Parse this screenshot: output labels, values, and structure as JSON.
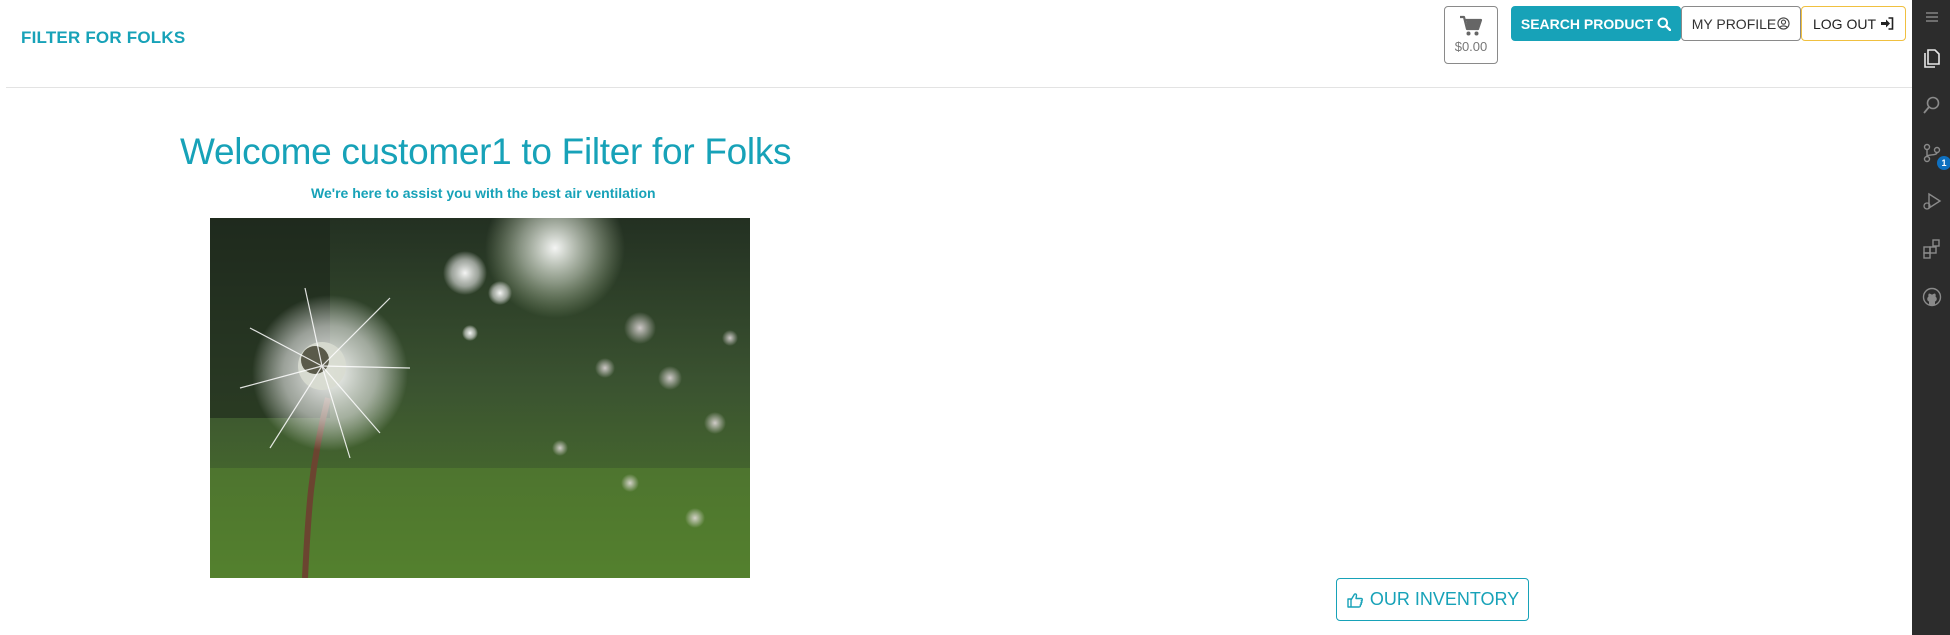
{
  "navbar": {
    "brand": "FILTER FOR FOLKS",
    "cart": {
      "icon": "shopping-cart-icon",
      "total": "$0.00"
    },
    "search_button": {
      "label": "SEARCH PRODUCT",
      "icon": "search-icon"
    },
    "profile_button": {
      "label": "MY PROFILE",
      "icon": "user-circle-icon"
    },
    "logout_button": {
      "label": "LOG OUT",
      "icon": "sign-in-icon"
    }
  },
  "main": {
    "welcome": "Welcome customer1 to Filter for Folks",
    "subtitle": "We're here to assist you with the best air ventilation",
    "hero_image": "dandelion-photo",
    "inventory_button": {
      "label": "OUR INVENTORY",
      "icon": "hand-pointing-icon"
    }
  },
  "activity_bar": {
    "items": [
      "menu-icon",
      "files-icon",
      "search-icon",
      "source-control-icon",
      "run-debug-icon",
      "extensions-icon",
      "github-icon"
    ],
    "source_control_badge": "1"
  },
  "colors": {
    "accent": "#17a2b8",
    "logout_border": "#f0c040",
    "activity_bar_bg": "#2c2c2c",
    "badge": "#0e70c0"
  }
}
